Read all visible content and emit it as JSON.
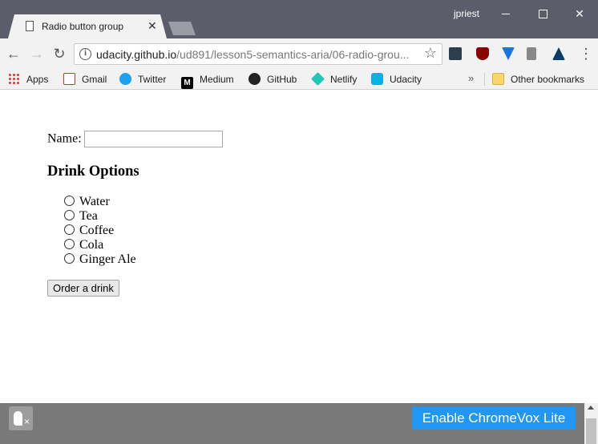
{
  "window": {
    "user": "jpriest",
    "minimize_glyph": "",
    "close_glyph": "✕"
  },
  "tab": {
    "title": "Radio button group",
    "close_glyph": "✕"
  },
  "toolbar": {
    "back_glyph": "←",
    "forward_glyph": "→",
    "reload_glyph": "↻",
    "info_glyph": "i",
    "url_host": "udacity.github.io",
    "url_path": "/ud891/lesson5-semantics-aria/06-radio-grou...",
    "star_glyph": "☆",
    "menu_glyph": "⋮",
    "extensions": [
      "udacity-ext-icon",
      "ublock-icon",
      "vimium-icon",
      "readability-icon",
      "drive-icon"
    ]
  },
  "bookmarks": {
    "items": [
      {
        "label": "Apps",
        "icon": "apps-grid-icon"
      },
      {
        "label": "Gmail",
        "icon": "gmail-icon"
      },
      {
        "label": "Twitter",
        "icon": "twitter-icon"
      },
      {
        "label": "Medium",
        "icon": "medium-icon"
      },
      {
        "label": "GitHub",
        "icon": "github-icon"
      },
      {
        "label": "Netlify",
        "icon": "netlify-icon"
      },
      {
        "label": "Udacity",
        "icon": "udacity-icon"
      }
    ],
    "overflow_glyph": "»",
    "other_label": "Other bookmarks",
    "medium_letter": "M"
  },
  "page": {
    "name_label": "Name:",
    "name_value": "",
    "heading": "Drink Options",
    "options": [
      "Water",
      "Tea",
      "Coffee",
      "Cola",
      "Ginger Ale"
    ],
    "selected": null,
    "order_button": "Order a drink"
  },
  "chromevox": {
    "enable_label": "Enable ChromeVox Lite",
    "icon_glyph": "×"
  },
  "colors": {
    "titlebar": "#5b5e6a",
    "toolbar": "#f2f2f2",
    "chromevox_bar": "#797979",
    "chromevox_button": "#2196f3"
  }
}
